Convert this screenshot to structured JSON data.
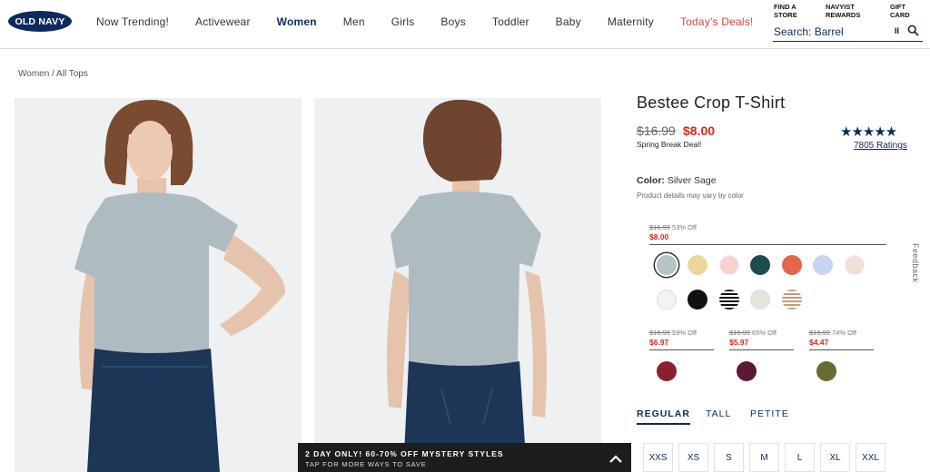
{
  "brand": {
    "logo_text": "OLD NAVY"
  },
  "nav": {
    "items": [
      {
        "label": "Now Trending!"
      },
      {
        "label": "Activewear"
      },
      {
        "label": "Women"
      },
      {
        "label": "Men"
      },
      {
        "label": "Girls"
      },
      {
        "label": "Boys"
      },
      {
        "label": "Toddler"
      },
      {
        "label": "Baby"
      },
      {
        "label": "Maternity"
      },
      {
        "label": "Today's Deals!"
      }
    ]
  },
  "utility": {
    "find_store_1": "FIND A",
    "find_store_2": "STORE",
    "rewards_1": "NAVYIST",
    "rewards_2": "REWARDS",
    "gift_1": "GIFT",
    "gift_2": "CARD"
  },
  "search": {
    "text": "Search: Barrel",
    "pause_label": "II"
  },
  "breadcrumb": "Women / All Tops",
  "product": {
    "title": "Bestee Crop T-Shirt",
    "price_old": "$16.99",
    "price_new": "$8.00",
    "deal_label": "Spring Break Deal!",
    "stars": "★★★★★",
    "ratings": "7805 Ratings",
    "color_label": "Color:",
    "color_value": "Silver Sage",
    "vary_note": "Product details may vary by color"
  },
  "price_groups": [
    {
      "old": "$16.99",
      "off": "53% Off",
      "new": "$8.00"
    },
    {
      "old": "$16.99",
      "off": "59% Off",
      "new": "$6.97"
    },
    {
      "old": "$16.99",
      "off": "65% Off",
      "new": "$5.97"
    },
    {
      "old": "$16.99",
      "off": "74% Off",
      "new": "$4.47"
    }
  ],
  "swatch_colors": {
    "row1": [
      "#b4c3c6",
      "#ecd79a",
      "#f7d3d0",
      "#1b4d4d",
      "#e2664c",
      "#c9d4ee",
      "#f0e0d6"
    ],
    "row2": [
      "#f3f3f3",
      "#111111",
      "stripe-dark",
      "#e5e3de",
      "stripe-tan"
    ],
    "group2": "#8c1f2d",
    "group3": "#5a1a36",
    "group4": "#6a6b34"
  },
  "fit_tabs": [
    {
      "label": "REGULAR"
    },
    {
      "label": "TALL"
    },
    {
      "label": "PETITE"
    }
  ],
  "sizes": [
    "XXS",
    "XS",
    "S",
    "M",
    "L",
    "XL",
    "XXL"
  ],
  "feedback": "Feedback",
  "promo": {
    "line1": "2 DAY ONLY! 60-70% OFF MYSTERY STYLES",
    "line2": "TAP FOR MORE WAYS TO SAVE"
  },
  "colors": {
    "brand_navy": "#0d2a5c",
    "sale_red": "#d9261c",
    "deal_red": "#d9453a"
  }
}
